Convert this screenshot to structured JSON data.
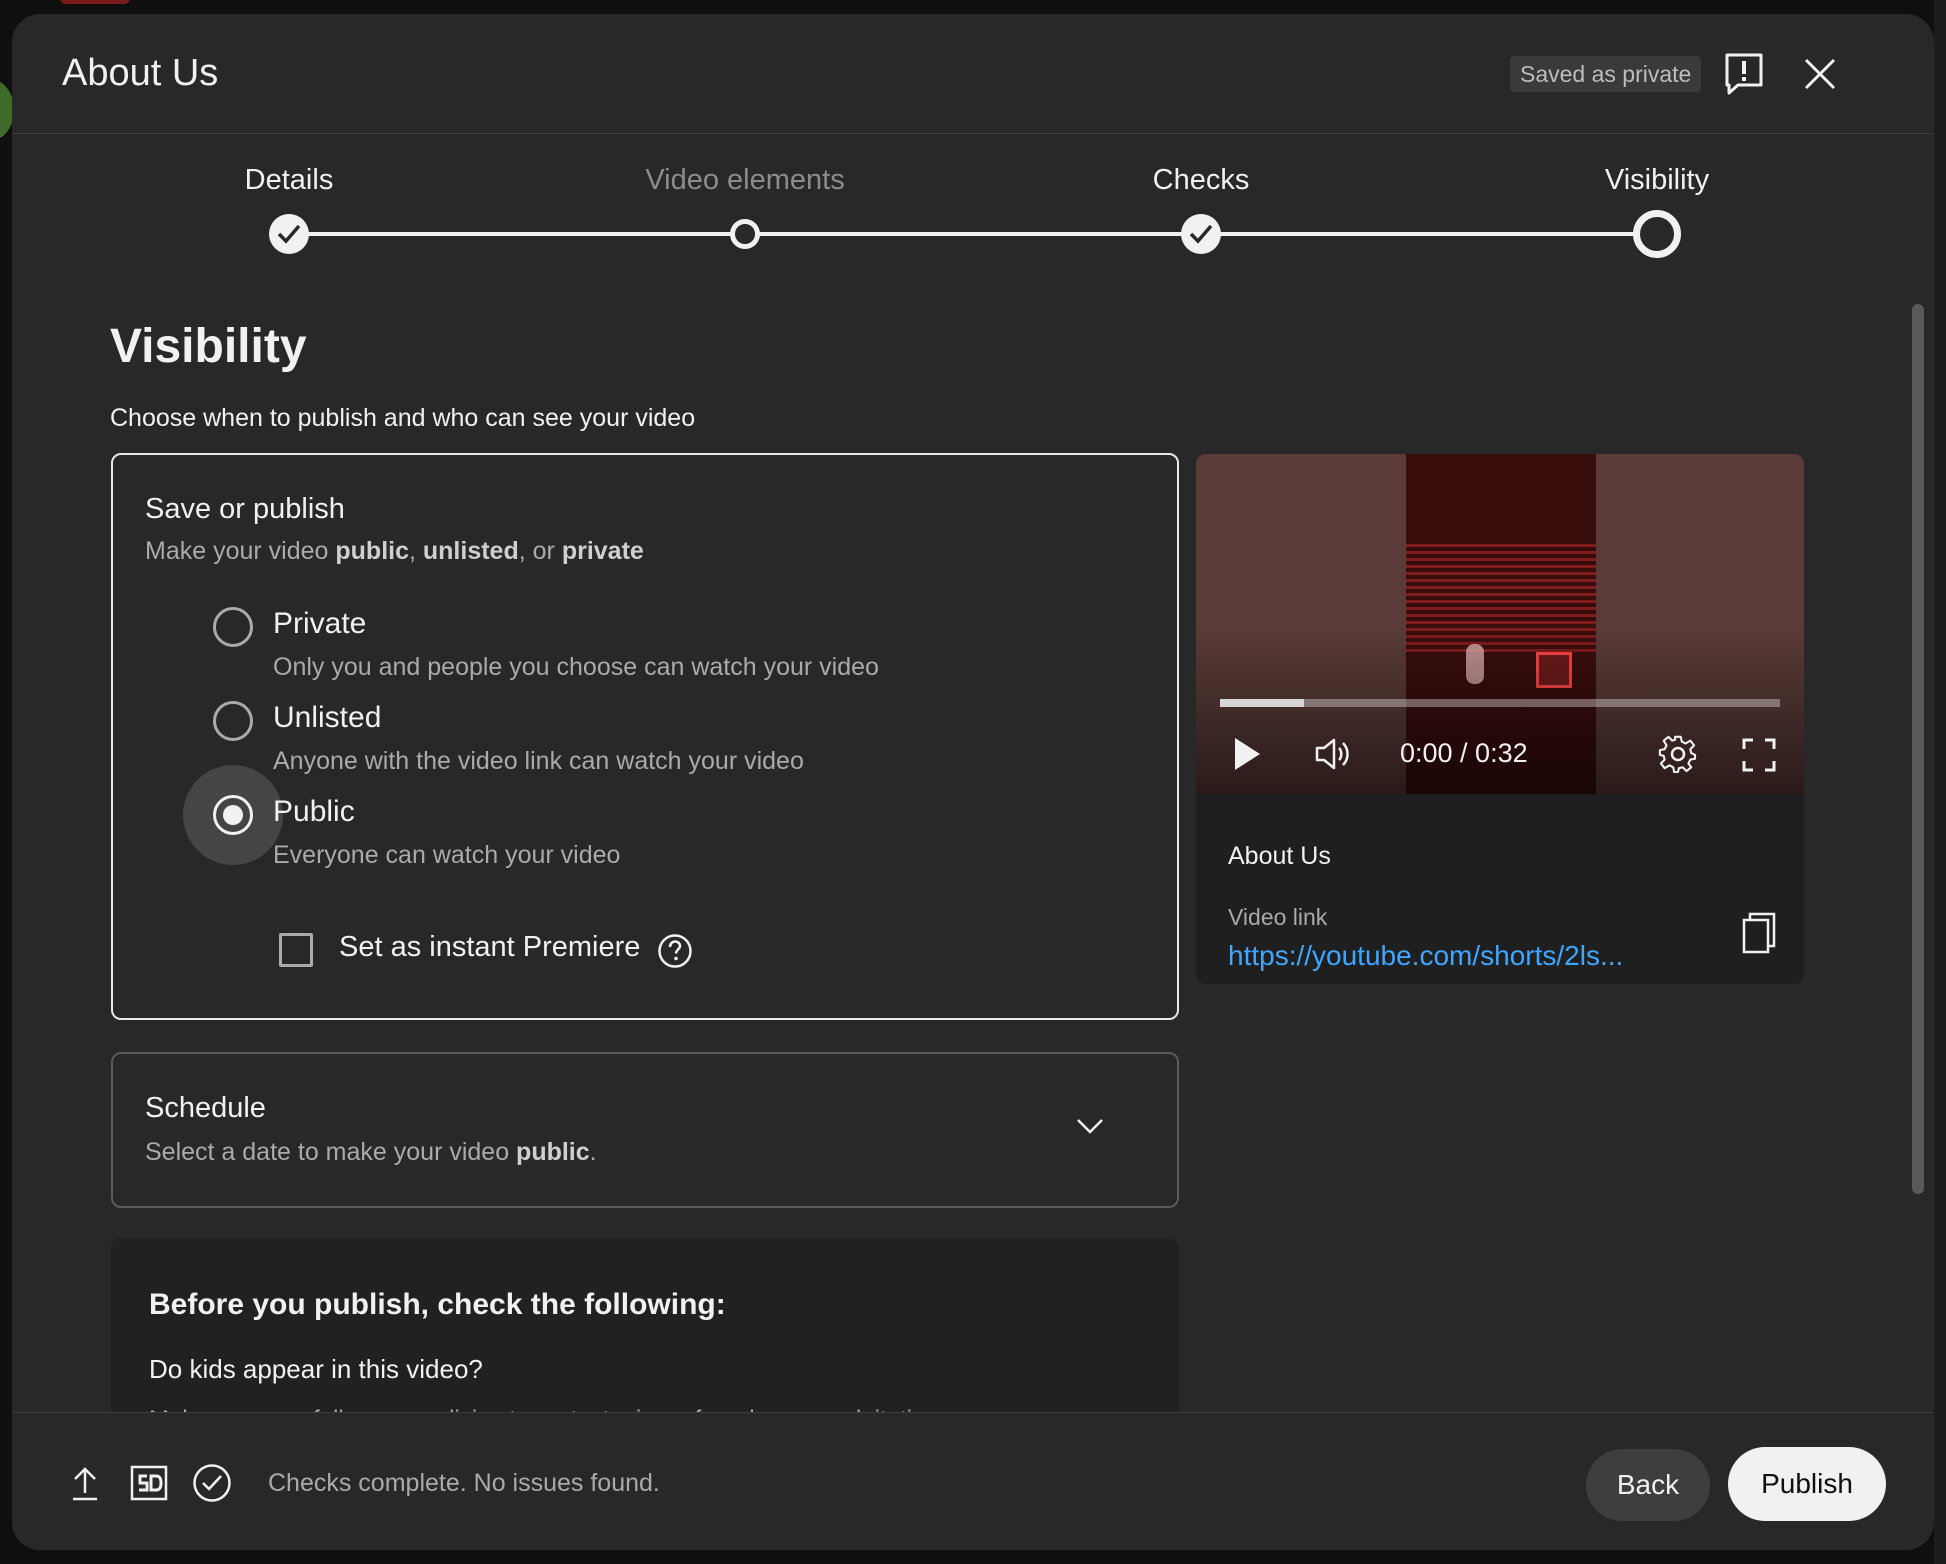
{
  "dialog": {
    "title": "About Us",
    "saved_badge": "Saved as private"
  },
  "stepper": {
    "steps": [
      {
        "label": "Details",
        "state": "done"
      },
      {
        "label": "Video elements",
        "state": "skipped"
      },
      {
        "label": "Checks",
        "state": "done"
      },
      {
        "label": "Visibility",
        "state": "current"
      }
    ]
  },
  "visibility": {
    "title": "Visibility",
    "subtitle": "Choose when to publish and who can see your video",
    "save_or_publish": {
      "title": "Save or publish",
      "desc_prefix": "Make your video ",
      "desc_public": "public",
      "desc_sep1": ", ",
      "desc_unlisted": "unlisted",
      "desc_sep2": ", or ",
      "desc_private": "private",
      "options": [
        {
          "label": "Private",
          "desc": "Only you and people you choose can watch your video",
          "checked": false
        },
        {
          "label": "Unlisted",
          "desc": "Anyone with the video link can watch your video",
          "checked": false
        },
        {
          "label": "Public",
          "desc": "Everyone can watch your video",
          "checked": true
        }
      ],
      "premiere_label": "Set as instant Premiere",
      "premiere_checked": false
    },
    "schedule": {
      "title": "Schedule",
      "desc_prefix": "Select a date to make your video ",
      "desc_bold": "public",
      "desc_suffix": "."
    },
    "before_publish": {
      "title": "Before you publish, check the following:",
      "question": "Do kids appear in this video?",
      "text": "Make sure you follow our policies to protect minors from harm, exploitation,"
    }
  },
  "preview": {
    "time": "0:00 / 0:32",
    "progress_buffered": 0.15,
    "title": "About Us",
    "link_label": "Video link",
    "link_value": "https://youtube.com/shorts/2ls..."
  },
  "footer": {
    "status": "Checks complete. No issues found.",
    "back_label": "Back",
    "publish_label": "Publish"
  },
  "colors": {
    "dialog_bg": "#282828",
    "link": "#3ea6ff",
    "publish_bg": "#f1f1f1"
  },
  "icons": [
    "feedback-icon",
    "close-icon",
    "check-icon",
    "help-icon",
    "chevron-down-icon",
    "play-icon",
    "volume-icon",
    "gear-icon",
    "fullscreen-icon",
    "copy-icon",
    "upload-icon",
    "sd-icon",
    "check-circle-icon"
  ]
}
